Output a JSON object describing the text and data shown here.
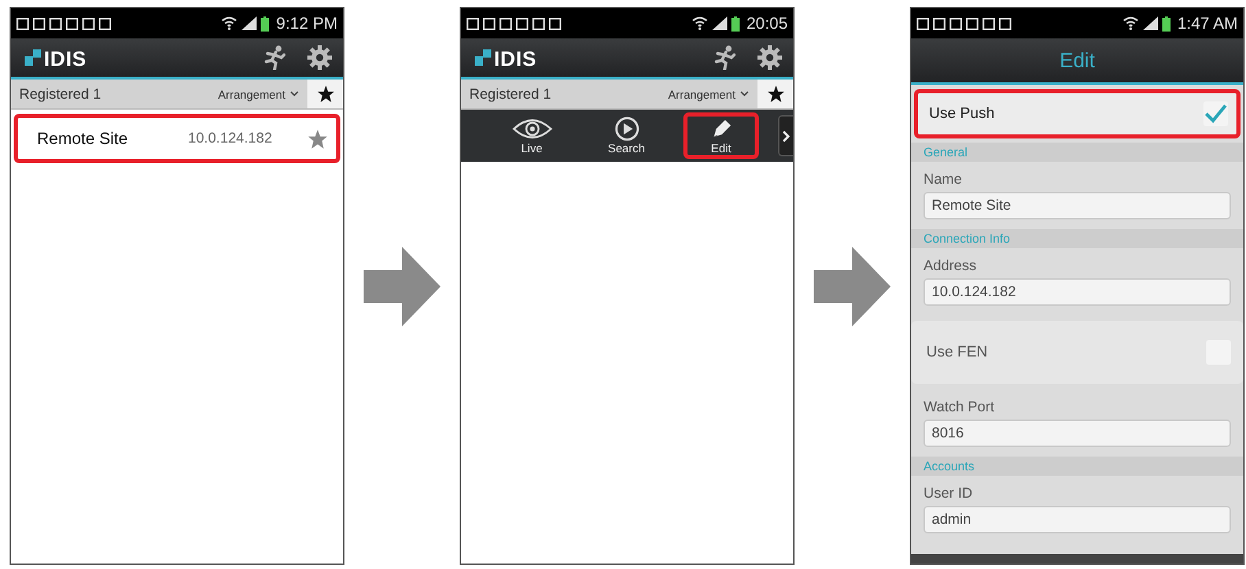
{
  "screens": [
    {
      "kind": "site_list",
      "status_bar": {
        "time": "9:12 PM"
      },
      "app_bar": {
        "logo": "IDIS"
      },
      "filter_bar": {
        "label": "Registered 1",
        "sort": "Arrangement"
      },
      "sites": [
        {
          "name": "Remote Site",
          "address": "10.0.124.182",
          "highlighted": true
        }
      ]
    },
    {
      "kind": "site_actions",
      "status_bar": {
        "time": "20:05"
      },
      "app_bar": {
        "logo": "IDIS"
      },
      "filter_bar": {
        "label": "Registered 1",
        "sort": "Arrangement"
      },
      "actions": [
        {
          "label": "Live",
          "highlighted": false
        },
        {
          "label": "Search",
          "highlighted": false
        },
        {
          "label": "Edit",
          "highlighted": true
        }
      ]
    },
    {
      "kind": "edit",
      "status_bar": {
        "time": "1:47 AM"
      },
      "title": "Edit",
      "items": [
        {
          "kind": "toggle",
          "label": "Use Push",
          "checked": true,
          "highlighted": true
        },
        {
          "kind": "section",
          "label": "General"
        },
        {
          "kind": "field",
          "label": "Name",
          "value": "Remote Site"
        },
        {
          "kind": "section",
          "label": "Connection Info"
        },
        {
          "kind": "field",
          "label": "Address",
          "value": "10.0.124.182"
        },
        {
          "kind": "toggle",
          "label": "Use FEN",
          "checked": false,
          "highlighted": false
        },
        {
          "kind": "field",
          "label": "Watch Port",
          "value": "8016"
        },
        {
          "kind": "section",
          "label": "Accounts"
        },
        {
          "kind": "field",
          "label": "User ID",
          "value": "admin"
        }
      ]
    }
  ]
}
